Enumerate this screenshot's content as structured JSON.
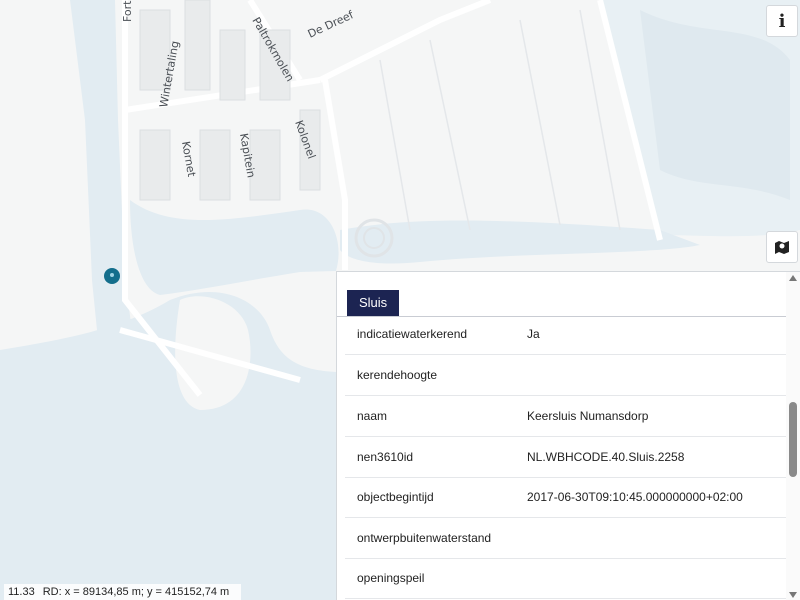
{
  "map": {
    "street_labels": [
      "Fort",
      "De Dreef",
      "Paltrokmolen",
      "Wintertaling",
      "Kornet",
      "Kapitein",
      "Kolonel"
    ],
    "marker_icon": "location-pin-icon",
    "colors": {
      "water": "#e2ecf2",
      "land": "#f5f6f6",
      "roads": "#ffffff",
      "marker": "#136e8c"
    }
  },
  "controls": {
    "info_label": "i",
    "layers_icon": "map-layers-icon"
  },
  "panel": {
    "tab_label": "Sluis",
    "rows": [
      {
        "key": "indicatiewaterkerend",
        "value": "Ja"
      },
      {
        "key": "kerendehoogte",
        "value": ""
      },
      {
        "key": "naam",
        "value": "Keersluis Numansdorp"
      },
      {
        "key": "nen3610id",
        "value": "NL.WBHCODE.40.Sluis.2258"
      },
      {
        "key": "objectbegintijd",
        "value": "2017-06-30T09:10:45.000000000+02:00"
      },
      {
        "key": "ontwerpbuitenwaterstand",
        "value": ""
      },
      {
        "key": "openingspeil",
        "value": ""
      }
    ]
  },
  "status": {
    "zoom": "11.33",
    "coords": "RD: x = 89134,85 m; y = 415152,74 m"
  }
}
